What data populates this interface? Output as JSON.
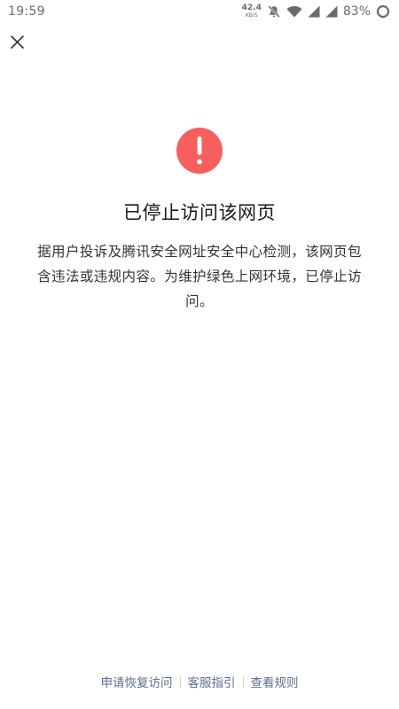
{
  "status_bar": {
    "time": "19:59",
    "net_speed_value": "42.4",
    "net_speed_unit": "KB/S",
    "battery_percent": "83%",
    "icons": [
      "bell-muted-icon",
      "wifi-icon",
      "signal-icon",
      "signal-icon",
      "battery-ring-icon"
    ]
  },
  "header": {
    "close_icon": "close-icon"
  },
  "warning": {
    "icon": "exclamation-icon",
    "icon_color": "#f75f5e",
    "title": "已停止访问该网页",
    "description": "据用户投诉及腾讯安全网址安全中心检测，该网页包含违法或违规内容。为维护绿色上网环境，已停止访问。"
  },
  "footer": {
    "links": [
      "申请恢复访问",
      "客服指引",
      "查看规则"
    ],
    "link_color": "#5c6e8c"
  }
}
